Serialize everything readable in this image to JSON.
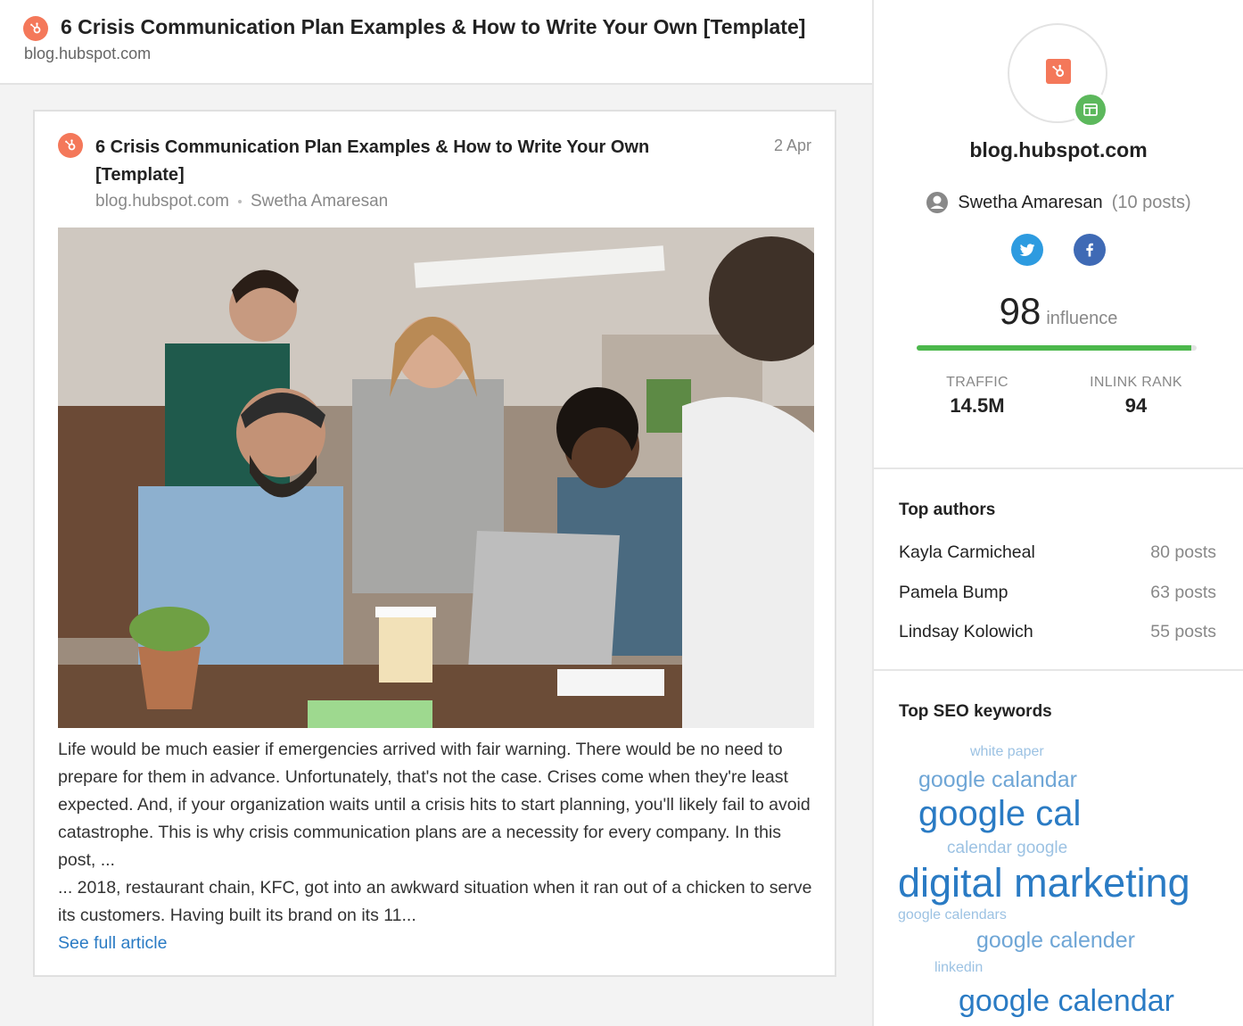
{
  "header": {
    "title": "6 Crisis Communication Plan Examples & How to Write Your Own [Template]",
    "domain": "blog.hubspot.com"
  },
  "article": {
    "title": "6 Crisis Communication Plan Examples & How to Write Your Own [Template]",
    "date": "2 Apr",
    "domain": "blog.hubspot.com",
    "author": "Swetha Amaresan",
    "excerpt_1": "Life would be much easier if emergencies arrived with fair warning. There would be no need to prepare for them in advance. Unfortunately, that's not the case. Crises come when they're least expected. And, if your organization waits until a crisis hits to start planning, you'll likely fail to avoid catastrophe. This is why crisis communication plans are a necessity for every company. In this post, ...",
    "excerpt_2": "... 2018, restaurant chain, KFC, got into an awkward situation when it ran out of a chicken to serve its customers. Having built its brand on its 11...",
    "see_full": "See full article"
  },
  "profile": {
    "domain": "blog.hubspot.com",
    "author_name": "Swetha Amaresan",
    "author_posts": "(10 posts)",
    "influence_value": "98",
    "influence_label": "influence",
    "influence_fraction": 0.98,
    "traffic_label": "TRAFFIC",
    "traffic_value": "14.5M",
    "inlink_label": "INLINK RANK",
    "inlink_value": "94"
  },
  "top_authors": {
    "title": "Top authors",
    "items": [
      {
        "name": "Kayla Carmicheal",
        "posts": "80 posts"
      },
      {
        "name": "Pamela Bump",
        "posts": "63 posts"
      },
      {
        "name": "Lindsay Kolowich",
        "posts": "55 posts"
      }
    ]
  },
  "seo": {
    "title": "Top SEO keywords",
    "keywords": [
      "white paper",
      "google calandar",
      "google cal",
      "calendar google",
      "digital marketing",
      "google calendars",
      "google calender",
      "linkedin",
      "google calendar"
    ]
  },
  "colors": {
    "hubspot_orange": "#f4785a",
    "link_blue": "#2a7bc4",
    "influence_green": "#4cb84c",
    "twitter_blue": "#2d9be0",
    "facebook_blue": "#3f6ab5"
  }
}
